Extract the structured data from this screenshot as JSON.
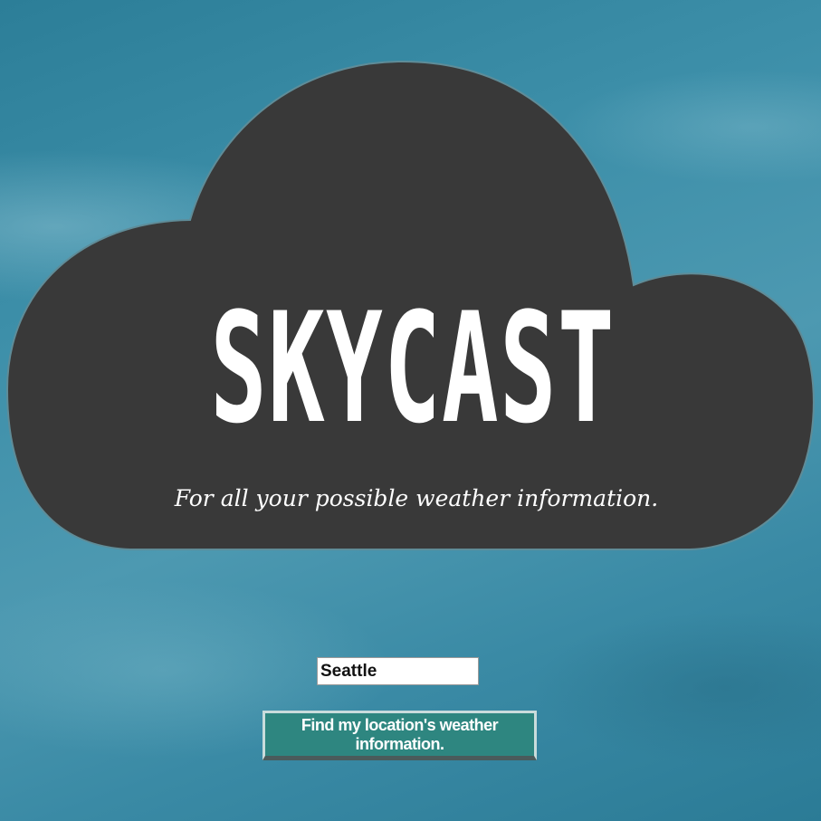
{
  "brand": {
    "logo_text": "SKYCAST",
    "tagline": "For all your possible weather information."
  },
  "search": {
    "value": "Seattle"
  },
  "actions": {
    "find_label": "Find my location's weather information."
  },
  "colors": {
    "sky_background": "#3d8fa9",
    "cloud": "#393939",
    "button": "#2e8680",
    "text": "#ffffff"
  },
  "icons": {
    "cloud": "cloud-shape"
  }
}
